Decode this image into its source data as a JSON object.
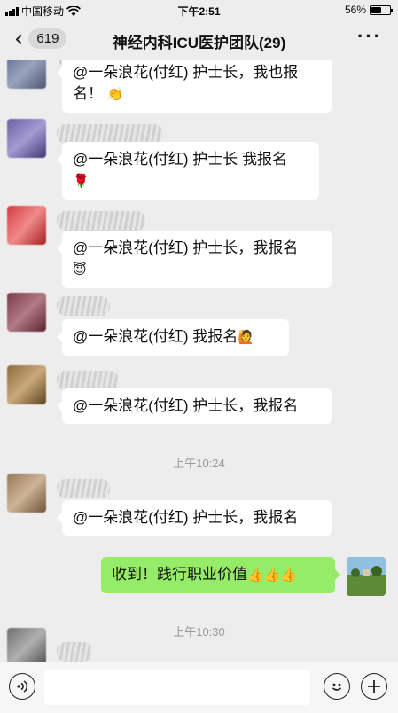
{
  "status_bar": {
    "carrier": "中国移动",
    "time": "下午2:51",
    "battery": "56%",
    "battery_level": 0.56
  },
  "nav": {
    "back_badge": "619",
    "title": "神经内科ICU医护团队(29)",
    "more": "···"
  },
  "messages": [
    {
      "line1": "@一朵浪花(付红) 护士长，我也报",
      "line2": "名！",
      "emoji": "👏"
    },
    {
      "line1": "@一朵浪花(付红) 护士长 我报名",
      "line2": "",
      "emoji": "🌹"
    },
    {
      "line1": "@一朵浪花(付红) 护士长，我报名",
      "line2": "",
      "emoji": "😇"
    },
    {
      "line1": "@一朵浪花(付红) 我报名",
      "line2": "",
      "emoji": "🙋"
    },
    {
      "line1": "@一朵浪花(付红) 护士长，我报名",
      "line2": "",
      "emoji": ""
    },
    {
      "line1": "@一朵浪花(付红) 护士长，我报名",
      "line2": "",
      "emoji": ""
    }
  ],
  "timestamps": [
    "上午10:24",
    "上午10:30"
  ],
  "my_message": {
    "text": "收到！践行职业价值",
    "emoji": "👍👍👍"
  },
  "input": {
    "value": "",
    "placeholder": ""
  },
  "icons": {
    "voice": "voice-icon",
    "emoji": "emoji-icon",
    "plus": "plus-icon"
  },
  "colors": {
    "background": "#ededed",
    "my_bubble": "#95ec69",
    "other_bubble": "#ffffff"
  }
}
